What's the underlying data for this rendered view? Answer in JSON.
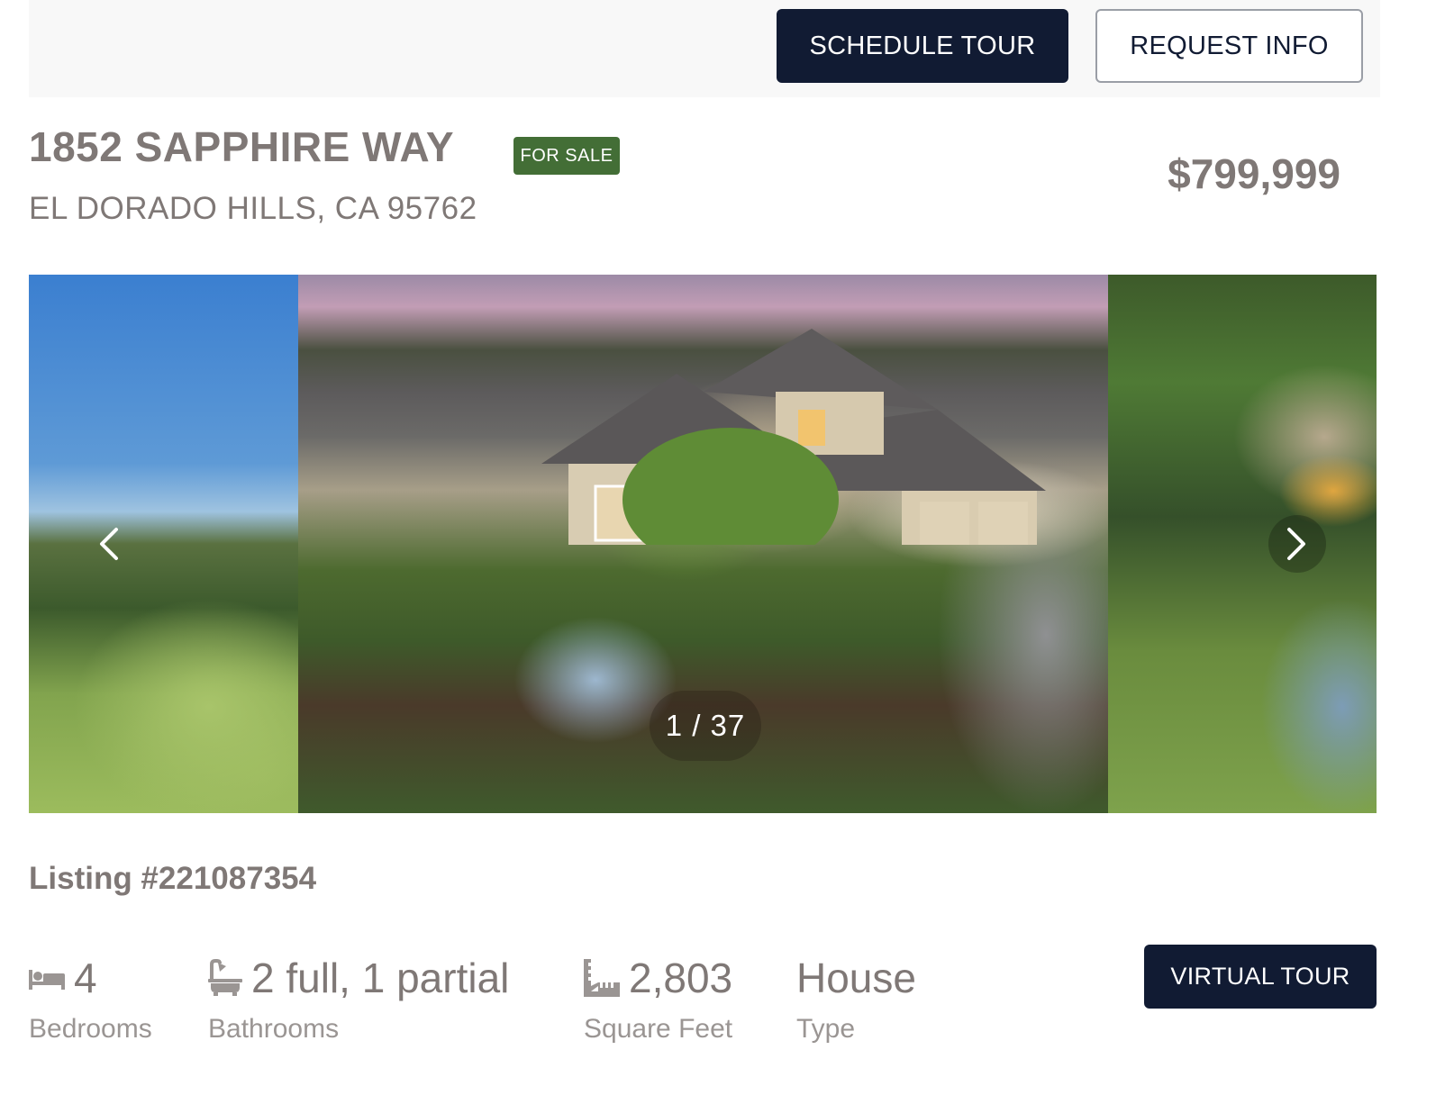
{
  "header": {
    "schedule_tour_label": "SCHEDULE TOUR",
    "request_info_label": "REQUEST INFO"
  },
  "property": {
    "street": "1852 SAPPHIRE WAY",
    "city_state_zip": "EL DORADO HILLS, CA 95762",
    "status": "FOR SALE",
    "price": "$799,999",
    "listing_number": "Listing #221087354"
  },
  "gallery": {
    "current": 1,
    "total": 37,
    "counter_text": "1 / 37",
    "prev_icon": "chevron-left-icon",
    "next_icon": "chevron-right-icon"
  },
  "stats": [
    {
      "icon": "bed-icon",
      "value": "4",
      "label": "Bedrooms"
    },
    {
      "icon": "bathtub-icon",
      "value": "2 full, 1 partial",
      "label": "Bathrooms"
    },
    {
      "icon": "ruler-icon",
      "value": "2,803",
      "label": "Square Feet"
    },
    {
      "icon": "",
      "value": "House",
      "label": "Type"
    }
  ],
  "actions": {
    "virtual_tour_label": "VIRTUAL TOUR"
  },
  "colors": {
    "primary_dark": "#111b33",
    "status_green": "#436e36",
    "text_gray": "#7f7876"
  }
}
